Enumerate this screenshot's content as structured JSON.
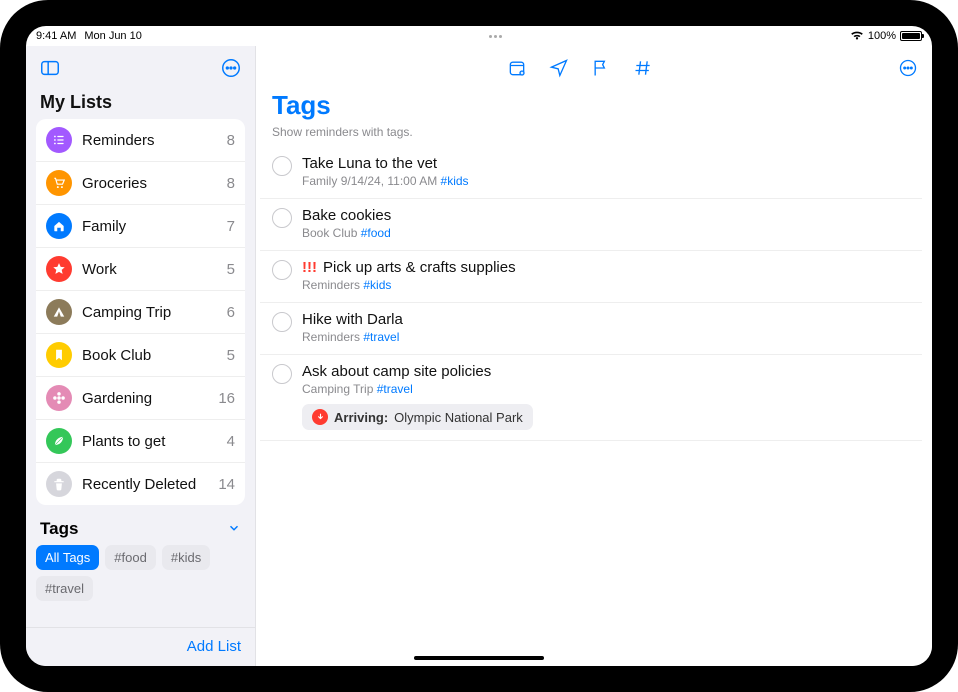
{
  "status": {
    "time": "9:41 AM",
    "date": "Mon Jun 10",
    "battery": "100%"
  },
  "sidebar": {
    "title": "My Lists",
    "lists": [
      {
        "name": "Reminders",
        "count": "8",
        "color": "#a259ff",
        "icon": "list"
      },
      {
        "name": "Groceries",
        "count": "8",
        "color": "#ff9500",
        "icon": "cart"
      },
      {
        "name": "Family",
        "count": "7",
        "color": "#007aff",
        "icon": "home"
      },
      {
        "name": "Work",
        "count": "5",
        "color": "#ff3b30",
        "icon": "star"
      },
      {
        "name": "Camping Trip",
        "count": "6",
        "color": "#8c7b5a",
        "icon": "tent"
      },
      {
        "name": "Book Club",
        "count": "5",
        "color": "#ffcc00",
        "icon": "bookmark"
      },
      {
        "name": "Gardening",
        "count": "16",
        "color": "#e48bb5",
        "icon": "flower"
      },
      {
        "name": "Plants to get",
        "count": "4",
        "color": "#34c759",
        "icon": "leaf"
      },
      {
        "name": "Recently Deleted",
        "count": "14",
        "color": "#d6d6dc",
        "icon": "trash"
      }
    ],
    "tags_title": "Tags",
    "tags": [
      {
        "label": "All Tags",
        "active": true
      },
      {
        "label": "#food",
        "active": false
      },
      {
        "label": "#kids",
        "active": false
      },
      {
        "label": "#travel",
        "active": false
      }
    ],
    "add_list": "Add List"
  },
  "main": {
    "title": "Tags",
    "subtitle": "Show reminders with tags.",
    "reminders": [
      {
        "title": "Take Luna to the vet",
        "meta_list": "Family",
        "meta_extra": "9/14/24, 11:00 AM",
        "tag": "#kids",
        "priority": ""
      },
      {
        "title": "Bake cookies",
        "meta_list": "Book Club",
        "meta_extra": "",
        "tag": "#food",
        "priority": ""
      },
      {
        "title": "Pick up arts & crafts supplies",
        "meta_list": "Reminders",
        "meta_extra": "",
        "tag": "#kids",
        "priority": "!!!"
      },
      {
        "title": "Hike with Darla",
        "meta_list": "Reminders",
        "meta_extra": "",
        "tag": "#travel",
        "priority": ""
      },
      {
        "title": "Ask about camp site policies",
        "meta_list": "Camping Trip",
        "meta_extra": "",
        "tag": "#travel",
        "priority": "",
        "location_label": "Arriving:",
        "location_value": "Olympic National Park"
      }
    ]
  }
}
